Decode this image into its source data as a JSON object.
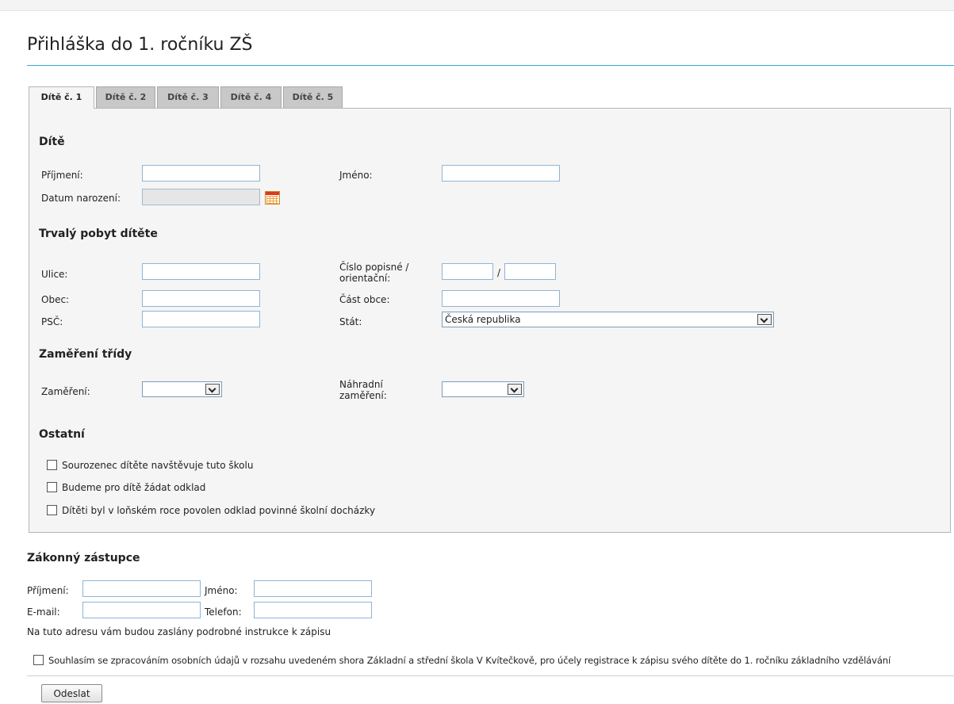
{
  "page": {
    "title": "Přihláška do 1. ročníku ZŠ"
  },
  "tabs": [
    {
      "label": "Dítě č. 1",
      "active": true
    },
    {
      "label": "Dítě č. 2",
      "active": false
    },
    {
      "label": "Dítě č. 3",
      "active": false
    },
    {
      "label": "Dítě č. 4",
      "active": false
    },
    {
      "label": "Dítě č. 5",
      "active": false
    }
  ],
  "child": {
    "heading": "Dítě",
    "surname_label": "Příjmení:",
    "surname_value": "",
    "name_label": "Jméno:",
    "name_value": "",
    "birthdate_label": "Datum narození:",
    "birthdate_value": ""
  },
  "address": {
    "heading": "Trvalý pobyt dítěte",
    "street_label": "Ulice:",
    "number_label": "Číslo popisné / orientační:",
    "number_separator": "/",
    "town_label": "Obec:",
    "town_part_label": "Část obce:",
    "zip_label": "PSČ:",
    "country_label": "Stát:",
    "country_value": "Česká republika"
  },
  "focus": {
    "heading": "Zaměření třídy",
    "focus_label": "Zaměření:",
    "focus_value": "",
    "alt_focus_label": "Náhradní zaměření:",
    "alt_focus_value": ""
  },
  "other": {
    "heading": "Ostatní",
    "checkboxes": [
      {
        "label": "Sourozenec dítěte navštěvuje tuto školu",
        "checked": false
      },
      {
        "label": "Budeme pro dítě žádat odklad",
        "checked": false
      },
      {
        "label": "Dítěti byl v loňském roce povolen odklad povinné školní docházky",
        "checked": false
      }
    ]
  },
  "guardian": {
    "heading": "Zákonný zástupce",
    "surname_label": "Příjmení:",
    "name_label": "Jméno:",
    "email_label": "E-mail:",
    "phone_label": "Telefon:",
    "note": "Na tuto adresu vám budou zaslány podrobné instrukce k zápisu"
  },
  "consent": {
    "label": "Souhlasím se zpracováním osobních údajů v rozsahu uvedeném shora Základní a střední škola V Kvítečkově, pro účely registrace k zápisu svého dítěte do 1. ročníku základního vzdělávání",
    "checked": false
  },
  "submit_label": "Odeslat",
  "colors": {
    "accent_rule": "#3aa9c9",
    "input_border": "#8fb4d6",
    "panel_bg": "#f5f5f5"
  },
  "icons": {
    "calendar": "calendar-icon",
    "dropdown": "chevron-down-icon"
  }
}
